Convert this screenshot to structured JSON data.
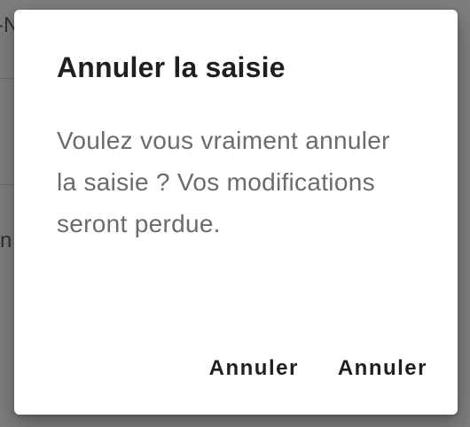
{
  "background": {
    "fragments": [
      "-N",
      "n"
    ]
  },
  "dialog": {
    "title": "Annuler la saisie",
    "message": "Voulez vous vraiment annuler la saisie ? Vos modifications seront perdue.",
    "buttons": [
      {
        "label": "Annuler"
      },
      {
        "label": "Annuler"
      }
    ]
  },
  "colors": {
    "scrim": "#7b7b7b",
    "surface": "#ffffff",
    "title_text": "#1f1f1f",
    "body_text": "#6b6b6b",
    "button_text": "#1f1f1f"
  }
}
